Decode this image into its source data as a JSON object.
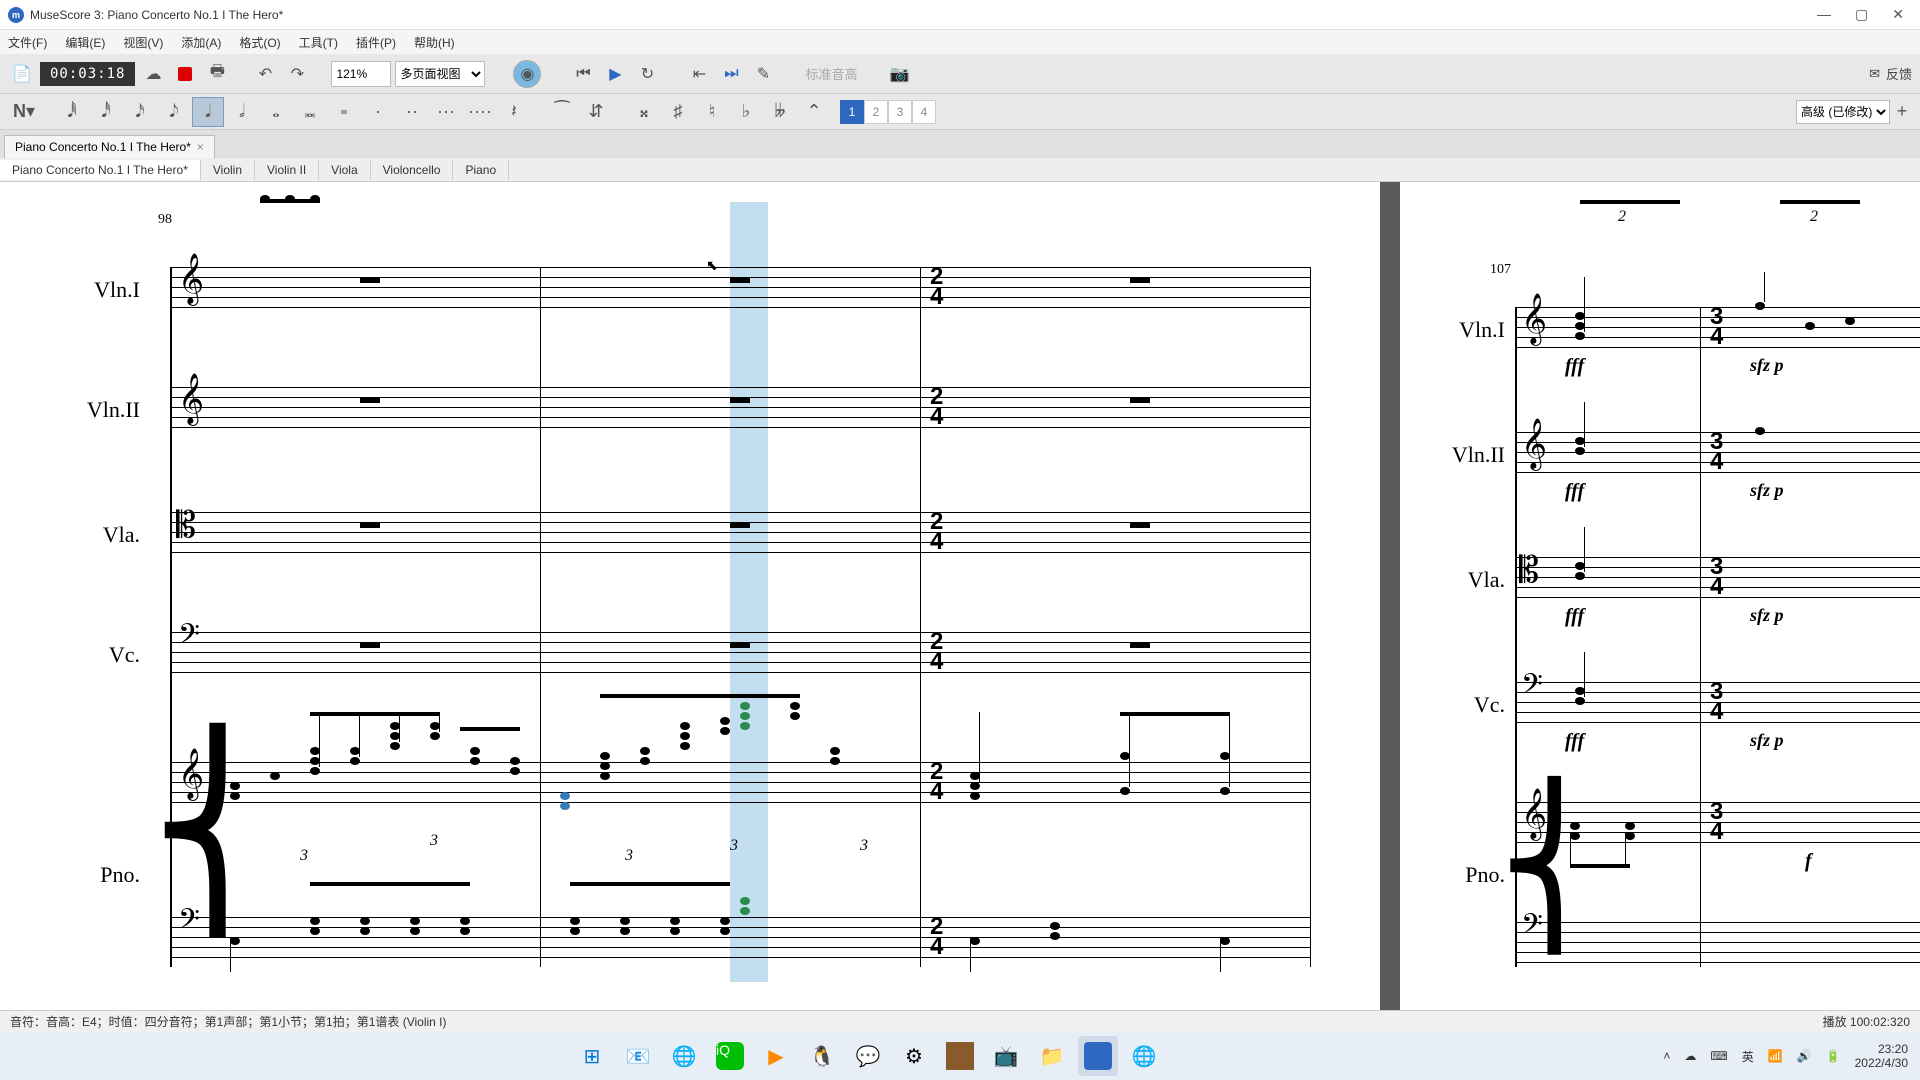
{
  "window": {
    "title": "MuseScore 3: Piano Concerto No.1 I The Hero*"
  },
  "menu": {
    "file": "文件(F)",
    "edit": "编辑(E)",
    "view": "视图(V)",
    "add": "添加(A)",
    "format": "格式(O)",
    "tools": "工具(T)",
    "plugins": "插件(P)",
    "help": "帮助(H)"
  },
  "toolbar": {
    "time": "00:03:18",
    "zoom": "121%",
    "view_mode": "多页面视图",
    "concert_pitch": "标准音高",
    "feedback": "反馈"
  },
  "voices": {
    "v1": "1",
    "v2": "2",
    "v3": "3",
    "v4": "4"
  },
  "workspace": "高级 (已修改)",
  "doc_tab": {
    "name": "Piano Concerto No.1 I The Hero*"
  },
  "parts": {
    "main": "Piano Concerto No.1 I The Hero*",
    "violin": "Violin",
    "violin2": "Violin II",
    "viola": "Viola",
    "cello": "Violoncello",
    "piano": "Piano"
  },
  "score": {
    "measure_left": "98",
    "measure_right": "107",
    "instruments": {
      "vln1": "Vln.I",
      "vln2": "Vln.II",
      "vla": "Vla.",
      "vc": "Vc.",
      "pno": "Pno."
    },
    "timesig": {
      "num": "2",
      "den": "4"
    },
    "timesig2": {
      "num": "3",
      "den": "4"
    },
    "tuplet3": "3",
    "tuplet2": "2",
    "dyn_fff": "fff",
    "dyn_sfzp": "sfz p",
    "dyn_f": "f"
  },
  "status": {
    "left": "音符：音高：E4；时值：四分音符；第1声部；第1小节；第1拍；第1谱表 (Violin I)",
    "right": "播放 100:02:320"
  },
  "taskbar": {
    "ime": "英",
    "time": "23:20",
    "date": "2022/4/30"
  }
}
